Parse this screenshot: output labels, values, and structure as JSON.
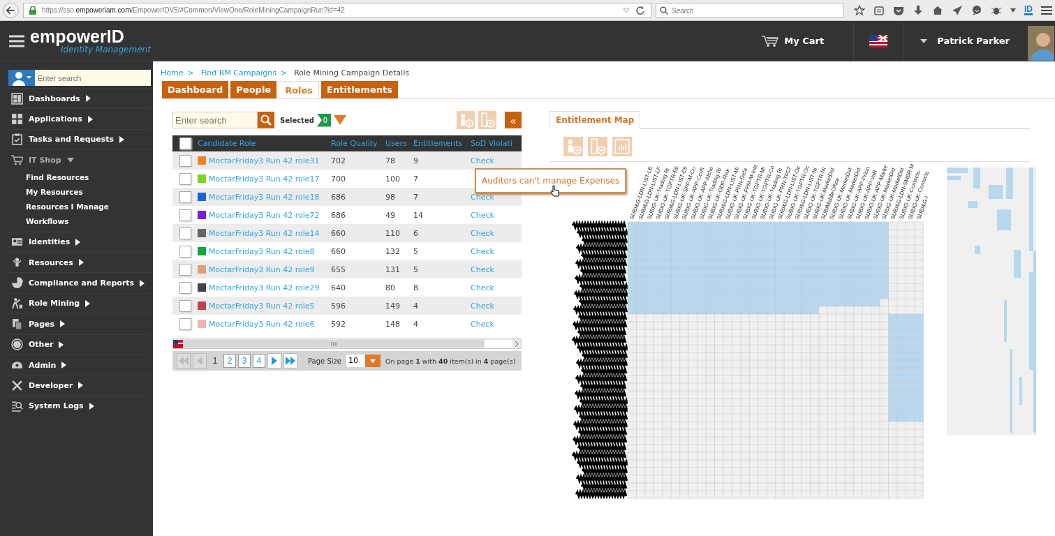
{
  "browser": {
    "url": "https://sso.**empoweriam.com**/EmpowerIDV5/#Common/ViewOne/RoleMiningCampaignRun?id=42",
    "search_placeholder": "Search",
    "toolbar_badge": "ID"
  },
  "header": {
    "logo": "empowerID",
    "logo_subtitle": "Identity Management",
    "cart": "My Cart",
    "user": "Patrick Parker"
  },
  "sidebar": {
    "search_placeholder": "Enter search",
    "items": [
      {
        "label": "Dashboards",
        "expanded": false
      },
      {
        "label": "Applications",
        "expanded": false
      },
      {
        "label": "Tasks and Requests",
        "expanded": false
      },
      {
        "label": "IT Shop",
        "expanded": true,
        "children": [
          {
            "label": "Find Resources"
          },
          {
            "label": "My Resources"
          },
          {
            "label": "Resources I Manage"
          },
          {
            "label": "Workflows"
          }
        ]
      },
      {
        "label": "Identities",
        "expanded": false
      },
      {
        "label": "Resources",
        "expanded": false
      },
      {
        "label": "Compliance and Reports",
        "expanded": false
      },
      {
        "label": "Role Mining",
        "expanded": false
      },
      {
        "label": "Pages",
        "expanded": false
      },
      {
        "label": "Other",
        "expanded": false
      },
      {
        "label": "Admin",
        "expanded": false
      },
      {
        "label": "Developer",
        "expanded": false
      },
      {
        "label": "System Logs",
        "expanded": false
      }
    ]
  },
  "breadcrumb": [
    {
      "label": "Home",
      "link": true,
      "separator": ">"
    },
    {
      "label": "Find RM Campaigns",
      "link": true,
      "separator": ">"
    },
    {
      "label": "Role Mining Campaign Details",
      "link": false
    }
  ],
  "tabs": [
    {
      "label": "Dashboard",
      "selected": false
    },
    {
      "label": "People",
      "selected": false
    },
    {
      "label": "Roles",
      "selected": true
    },
    {
      "label": "Entitlements",
      "selected": false
    }
  ],
  "roles_panel": {
    "search_placeholder": "Enter search",
    "selected_label": "Selected",
    "selected_count": "0",
    "collapse": "«",
    "columns": [
      "Candidate Role",
      "Role Quality",
      "Users",
      "Entitlements",
      "SoD Violati"
    ],
    "header_checked": false,
    "rows": [
      {
        "checked": false,
        "color": "#f58220",
        "name": "MoctarFriday3 Run 42 role31",
        "quality": "702",
        "users": "78",
        "entitlements": "9",
        "sod": "Check"
      },
      {
        "checked": false,
        "color": "#7ed321",
        "name": "MoctarFriday3 Run 42 role17",
        "quality": "700",
        "users": "100",
        "entitlements": "7"
      },
      {
        "checked": false,
        "color": "#1565d8",
        "name": "MoctarFriday3 Run 42 role18",
        "quality": "686",
        "users": "98",
        "entitlements": "7",
        "sod": "Check"
      },
      {
        "checked": false,
        "color": "#7b1fd6",
        "name": "MoctarFriday3 Run 42 role72",
        "quality": "686",
        "users": "49",
        "entitlements": "14",
        "sod": "Check"
      },
      {
        "checked": false,
        "color": "#666666",
        "name": "MoctarFriday3 Run 42 role14",
        "quality": "660",
        "users": "110",
        "entitlements": "6",
        "sod": "Check"
      },
      {
        "checked": false,
        "color": "#13a538",
        "name": "MoctarFriday3 Run 42 role8",
        "quality": "660",
        "users": "132",
        "entitlements": "5",
        "sod": "Check"
      },
      {
        "checked": false,
        "color": "#d9a07a",
        "name": "MoctarFriday3 Run 42 role9",
        "quality": "655",
        "users": "131",
        "entitlements": "5",
        "sod": "Check"
      },
      {
        "checked": false,
        "color": "#444444",
        "name": "MoctarFriday3 Run 42 role29",
        "quality": "640",
        "users": "80",
        "entitlements": "8",
        "sod": "Check"
      },
      {
        "checked": false,
        "color": "#c0414b",
        "name": "MoctarFriday3 Run 42 role5",
        "quality": "596",
        "users": "149",
        "entitlements": "4",
        "sod": "Check"
      },
      {
        "checked": false,
        "color": "#f2b3b3",
        "name": "MoctarFriday3 Run 42 role6",
        "quality": "592",
        "users": "148",
        "entitlements": "4",
        "sod": "Check"
      }
    ],
    "pages": [
      {
        "label": "1",
        "selected": true
      },
      {
        "label": "2",
        "selected": false
      },
      {
        "label": "3",
        "selected": false
      },
      {
        "label": "4",
        "selected": false
      }
    ],
    "page_size_label": "Page Size",
    "page_size": "10",
    "page_info": "On page **1** with **40** item(s) in **4** page(s)"
  },
  "tooltip": "Auditors can't manage Expenses",
  "entitlement_map": {
    "tab": "Entitlement Map",
    "column_labels": [
      "SUBI&G-LDN-LIST-LE",
      "SUBI&G-LDN-LIST-LF",
      "SUBIG-UK-Trading Ri",
      "SUBIG-UK-TGPTR-Eb",
      "SUBI&G-LDN-LIST-Eb",
      "SUBIG-UK-SPP-M-Co",
      "SUBIG-UK-APP-Confi",
      "SUBIG-UK-APP-Alche",
      "SUBIG-UK-Trading Ri",
      "SUBIG-UK-ODP-Risk",
      "SUBI&G-LDN-LIST-Mi",
      "SUBIG-UK-PRN-Defa",
      "SUBIG-UK-FPM-M-Inte",
      "SUBIG-UK-TGPTR-Mi",
      "SUBIG-UK-TGPTR-Co",
      "SUBIG-UK-Trading Ri",
      "SUBIG-UK-PRN-TP07",
      "SUBI&G-LDN-LIST-Oc",
      "SUBIG-UK-TGPTR-Oc",
      "SUBI&G-LDN-LIST-Ni",
      "SUBIG-UK-TGPTR-Ni",
      "SUBIG-UK-MarketDat",
      "SUBIMiddleOffice",
      "SUBIG-UK-MarketDat",
      "SUBIG-UK-MarketDat",
      "SUBIG-UK-APP-Pricin",
      "SUBIG-UK-APP-VaR",
      "SUBIG-UK-APP-Marke",
      "SUBIG-UK-MarketDat",
      "SUBIG-UK-MarketDat",
      "SUBI&G-LDN-SMBR-M",
      "SUBIG-UK-Contacts-",
      "SUBIG-UK-Contacts",
      "SUBI&G-I"
    ]
  }
}
